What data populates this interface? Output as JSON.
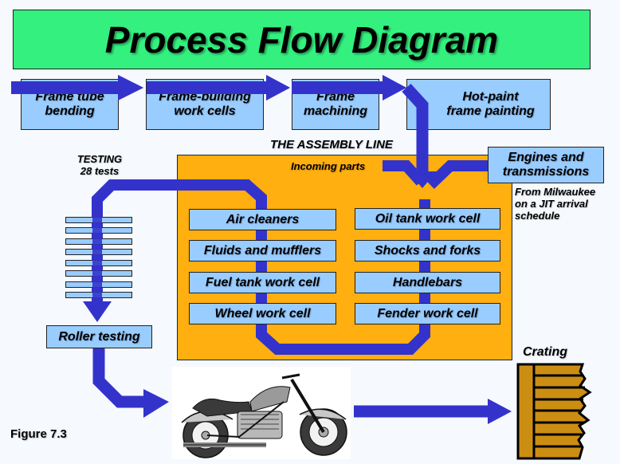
{
  "title": "Process Flow Diagram",
  "top_processes": [
    {
      "line1": "Frame tube",
      "line2": "bending"
    },
    {
      "line1": "Frame-building",
      "line2": "work cells"
    },
    {
      "line1": "Frame",
      "line2": "machining"
    },
    {
      "line1": "Hot-paint",
      "line2": "frame painting"
    }
  ],
  "assembly_line_label": "THE ASSEMBLY LINE",
  "incoming_parts_label": "Incoming parts",
  "engines_box": {
    "line1": "Engines and",
    "line2": "transmissions"
  },
  "milwaukee_note": {
    "line1": "From Milwaukee",
    "line2": "on a JIT arrival",
    "line3": "schedule"
  },
  "testing_label": {
    "line1": "TESTING",
    "line2": "28 tests"
  },
  "test_count_bars": 8,
  "work_cells_left": [
    "Air cleaners",
    "Fluids and mufflers",
    "Fuel tank work cell",
    "Wheel work cell"
  ],
  "work_cells_right": [
    "Oil tank work cell",
    "Shocks and forks",
    "Handlebars",
    "Fender work cell"
  ],
  "roller_testing": "Roller testing",
  "crating_label": "Crating",
  "figure_label": "Figure 7.3",
  "colors": {
    "title_bg": "#33f07f",
    "box_fill": "#99ccff",
    "assembly_bg": "#ffaf0f",
    "flow_arrow": "#3333cc",
    "crate": "#cc8e12"
  }
}
